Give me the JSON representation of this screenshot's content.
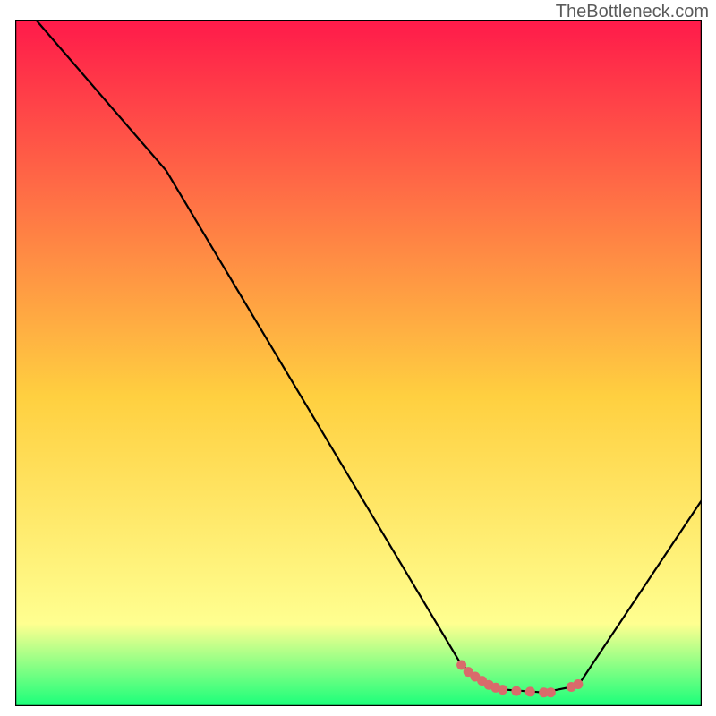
{
  "attribution": "TheBottleneck.com",
  "chart_data": {
    "type": "line",
    "title": "",
    "xlabel": "",
    "ylabel": "",
    "xlim": [
      0,
      100
    ],
    "ylim": [
      0,
      100
    ],
    "background_gradient": {
      "top_color": "#ff1a4a",
      "mid_color": "#ffd040",
      "low_color": "#ffff90",
      "bottom_color": "#19ff7a"
    },
    "series": [
      {
        "name": "bottleneck-curve",
        "color": "#000000",
        "points": [
          {
            "x": 3,
            "y": 100
          },
          {
            "x": 22,
            "y": 78
          },
          {
            "x": 65,
            "y": 6
          },
          {
            "x": 70,
            "y": 2.5
          },
          {
            "x": 77,
            "y": 2
          },
          {
            "x": 82,
            "y": 3
          },
          {
            "x": 100,
            "y": 30
          }
        ]
      }
    ],
    "markers": {
      "name": "highlight-dots",
      "color": "#d96b6b",
      "points": [
        {
          "x": 65,
          "y": 6
        },
        {
          "x": 66,
          "y": 5
        },
        {
          "x": 67,
          "y": 4.3
        },
        {
          "x": 68,
          "y": 3.7
        },
        {
          "x": 69,
          "y": 3.1
        },
        {
          "x": 70,
          "y": 2.7
        },
        {
          "x": 71,
          "y": 2.4
        },
        {
          "x": 73,
          "y": 2.2
        },
        {
          "x": 75,
          "y": 2.1
        },
        {
          "x": 77,
          "y": 2.0
        },
        {
          "x": 78,
          "y": 2.0
        },
        {
          "x": 81,
          "y": 2.8
        },
        {
          "x": 82,
          "y": 3.2
        }
      ]
    }
  }
}
